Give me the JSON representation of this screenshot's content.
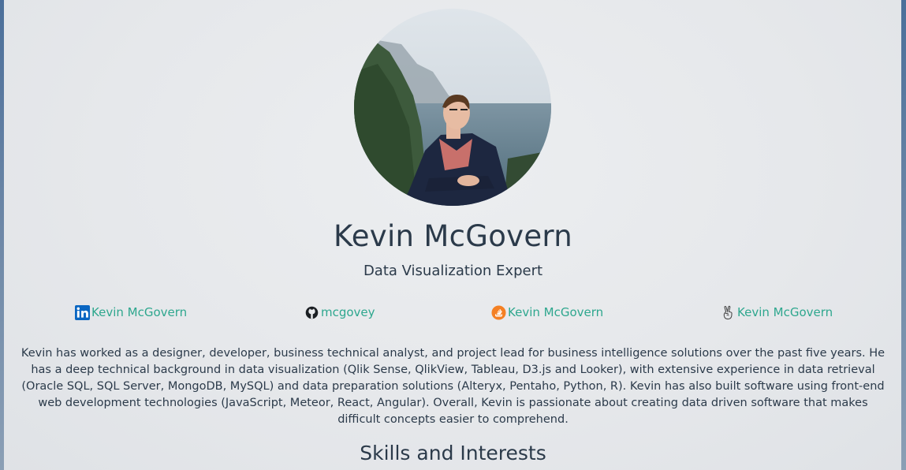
{
  "profile": {
    "name": "Kevin McGovern",
    "title": "Data Visualization Expert",
    "photo_alt": "Kevin McGovern"
  },
  "social_links": [
    {
      "label": "Kevin McGovern",
      "icon": "linkedin-icon"
    },
    {
      "label": "mcgovey",
      "icon": "github-icon"
    },
    {
      "label": "Kevin McGovern",
      "icon": "stackoverflow-icon"
    },
    {
      "label": "Kevin McGovern",
      "icon": "angellist-icon"
    }
  ],
  "bio": "Kevin has worked as a designer, developer, business technical analyst, and project lead for business intelligence solutions over the past five years. He has a deep technical background in data visualization (Qlik Sense, QlikView, Tableau, D3.js and Looker), with extensive experience in data retrieval (Oracle SQL, SQL Server, MongoDB, MySQL) and data preparation solutions (Alteryx, Pentaho, Python, R). Kevin has also built software using front-end web development technologies (JavaScript, Meteor, React, Angular). Overall, Kevin is passionate about creating data driven software that makes difficult concepts easier to comprehend.",
  "sections": {
    "skills_title": "Skills and Interests"
  },
  "colors": {
    "accent": "#2ea78e",
    "text": "#2b3a4a",
    "linkedin": "#0a66c2",
    "stackoverflow": "#f48024"
  }
}
